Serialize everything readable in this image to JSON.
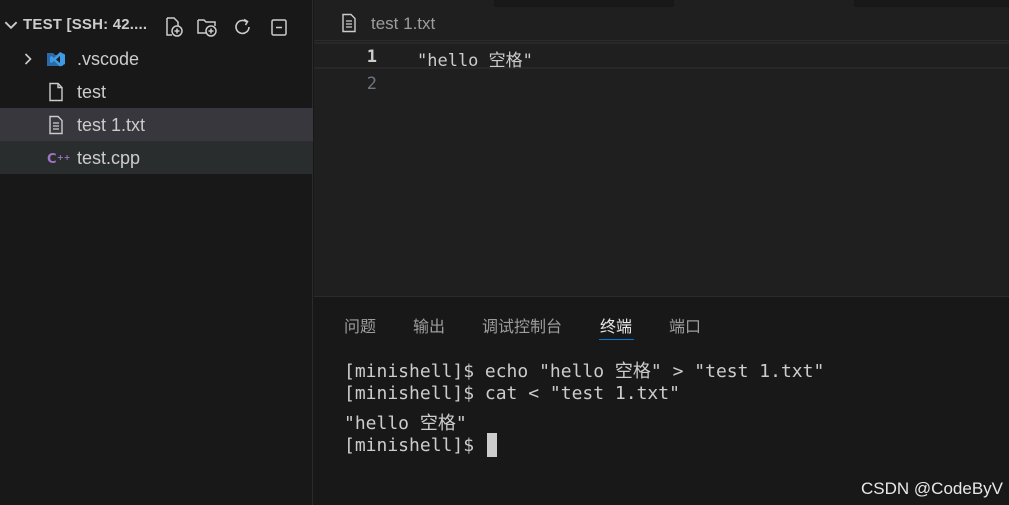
{
  "explorer": {
    "title": "TEST [SSH: 42....",
    "items": [
      {
        "label": ".vscode",
        "type": "folder"
      },
      {
        "label": "test",
        "type": "file"
      },
      {
        "label": "test 1.txt",
        "type": "text-file"
      },
      {
        "label": "test.cpp",
        "type": "cpp-file"
      }
    ]
  },
  "editor": {
    "tab_label": "test 1.txt",
    "lines": [
      {
        "number": "1",
        "text": "\"hello 空格\""
      },
      {
        "number": "2",
        "text": ""
      }
    ]
  },
  "panel": {
    "tabs": [
      "问题",
      "输出",
      "调试控制台",
      "终端",
      "端口"
    ],
    "active_tab": "终端",
    "terminal_lines": [
      "[minishell]$ echo \"hello 空格\" > \"test 1.txt\"",
      "[minishell]$ cat < \"test 1.txt\"",
      "\"hello 空格\"",
      "[minishell]$ "
    ]
  },
  "watermark": "CSDN @CodeByV",
  "colors": {
    "vscode_folder_blue": "#3e9ae5",
    "cpp_purple": "#a074c4",
    "accent": "#0078d4"
  }
}
